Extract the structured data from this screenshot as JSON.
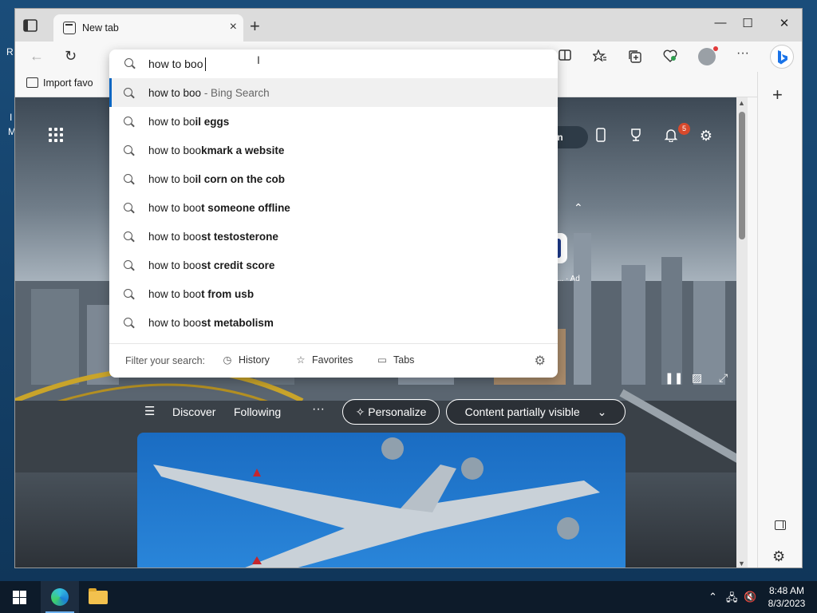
{
  "window": {
    "tab_title": "New tab",
    "tab_close": "×",
    "new_tab": "+",
    "minimize": "—",
    "maximize": "☐",
    "close": "✕"
  },
  "toolbar": {
    "back": "←",
    "refresh": "↻",
    "more": "···"
  },
  "favorites_bar": {
    "import_label": "Import favo"
  },
  "omnibox": {
    "query": "how to boo",
    "suggestions": [
      {
        "prefix": "how to boo",
        "bold": "",
        "hint": " - Bing Search",
        "active": true
      },
      {
        "prefix": "how to bo",
        "bold": "il eggs",
        "hint": ""
      },
      {
        "prefix": "how to boo",
        "bold": "kmark a website",
        "hint": ""
      },
      {
        "prefix": "how to bo",
        "bold": "il corn on the cob",
        "hint": ""
      },
      {
        "prefix": "how to boo",
        "bold": "t someone offline",
        "hint": ""
      },
      {
        "prefix": "how to boo",
        "bold": "st testosterone",
        "hint": ""
      },
      {
        "prefix": "how to boo",
        "bold": "st credit score",
        "hint": ""
      },
      {
        "prefix": "how to boo",
        "bold": "t from usb",
        "hint": ""
      },
      {
        "prefix": "how to boo",
        "bold": "st metabolism",
        "hint": ""
      }
    ],
    "filter_label": "Filter your search:",
    "filters": [
      "History",
      "Favorites",
      "Tabs"
    ]
  },
  "new_tab_page": {
    "signin_label": "gn in",
    "notification_count": "5",
    "ad_tile_letter": "B.",
    "ad_text": "ng.c... · Ad",
    "feed": {
      "discover": "Discover",
      "following": "Following",
      "more": "···",
      "personalize": "Personalize",
      "content_visibility": "Content partially visible"
    }
  },
  "taskbar": {
    "time": "8:48 AM",
    "date": "8/3/2023"
  },
  "desktop": {
    "edge_letters": [
      "R",
      "I",
      "M"
    ]
  },
  "colors": {
    "accent": "#0a66c2",
    "notification": "#d8492c",
    "taskbar": "#0d1b2a"
  }
}
